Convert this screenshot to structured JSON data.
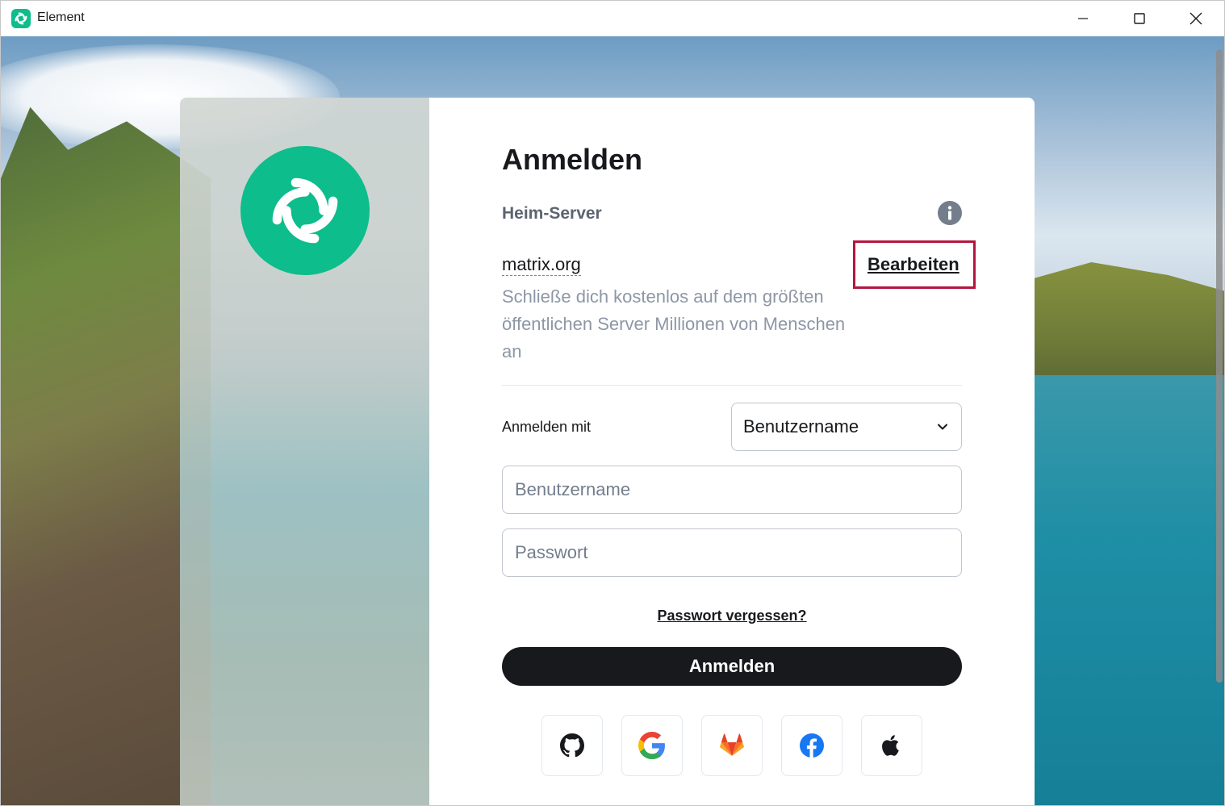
{
  "window": {
    "title": "Element"
  },
  "auth": {
    "title": "Anmelden",
    "homeserver_label": "Heim-Server",
    "server_name": "matrix.org",
    "edit_label": "Bearbeiten",
    "description": "Schließe dich kostenlos auf dem größten öffentlichen Server Millionen von Menschen an",
    "login_with_label": "Anmelden mit",
    "login_type_selected": "Benutzername",
    "username_placeholder": "Benutzername",
    "password_placeholder": "Passwort",
    "forgot_password": "Passwort vergessen?",
    "submit_label": "Anmelden",
    "sso_providers": [
      "github-icon",
      "google-icon",
      "gitlab-icon",
      "facebook-icon",
      "apple-icon"
    ]
  },
  "colors": {
    "brand": "#0dbd8b",
    "highlight": "#b3163f",
    "button": "#17191c"
  }
}
